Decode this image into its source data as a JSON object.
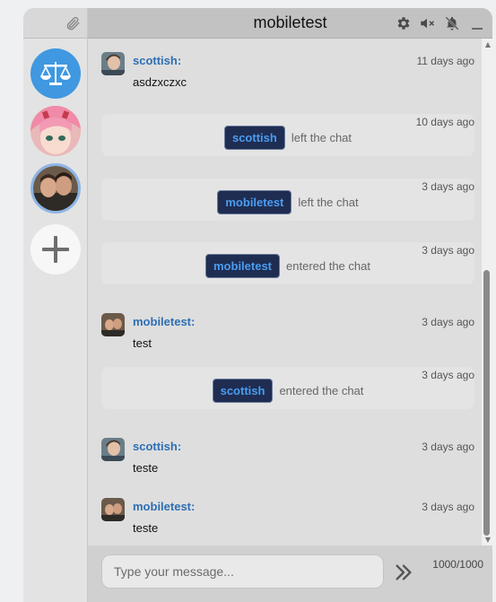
{
  "header": {
    "title": "mobiletest"
  },
  "sidebar": {
    "servers": [
      {
        "name": "scales-server",
        "icon": "scales-icon"
      },
      {
        "name": "anime-server",
        "icon": "anime-avatar"
      },
      {
        "name": "group-server",
        "icon": "group-avatar"
      },
      {
        "name": "add-server",
        "icon": "plus-icon"
      }
    ]
  },
  "messages": {
    "m1": {
      "author": "scottish:",
      "time": "11 days ago",
      "text": "asdzxczxc"
    },
    "e1": {
      "user": "scottish",
      "action": "left the chat",
      "time": "10 days ago"
    },
    "e2": {
      "user": "mobiletest",
      "action": "left the chat",
      "time": "3 days ago"
    },
    "e3": {
      "user": "mobiletest",
      "action": "entered the chat",
      "time": "3 days ago"
    },
    "m2": {
      "author": "mobiletest:",
      "time": "3 days ago",
      "text": "test"
    },
    "e4": {
      "user": "scottish",
      "action": "entered the chat",
      "time": "3 days ago"
    },
    "m3": {
      "author": "scottish:",
      "time": "3 days ago",
      "text": "teste"
    },
    "m4": {
      "author": "mobiletest:",
      "time": "3 days ago",
      "text": "teste"
    }
  },
  "composer": {
    "placeholder": "Type your message...",
    "counter": "1000/1000"
  },
  "colors": {
    "accent": "#3f98e0",
    "author": "#2d6fb4",
    "pill_bg": "#1f2d52",
    "pill_text": "#4a9df0"
  }
}
